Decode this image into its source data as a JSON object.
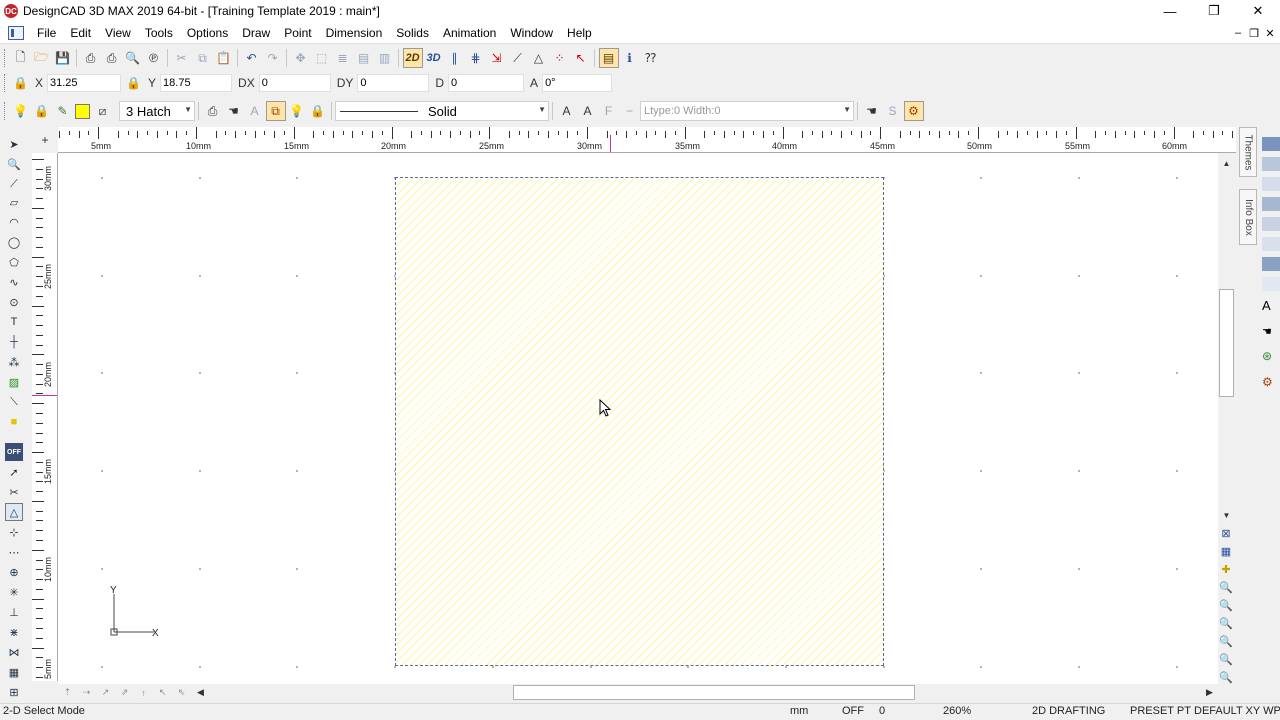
{
  "window": {
    "title": "DesignCAD 3D MAX 2019 64-bit - [Training Template 2019 : main*]",
    "app_icon": "DC",
    "controls": [
      "minimize-icon",
      "restore-icon",
      "close-icon"
    ]
  },
  "menu": {
    "items": [
      "File",
      "Edit",
      "View",
      "Tools",
      "Options",
      "Draw",
      "Point",
      "Dimension",
      "Solids",
      "Animation",
      "Window",
      "Help"
    ]
  },
  "coords": {
    "x_label": "X",
    "x_value": "31.25",
    "y_label": "Y",
    "y_value": "18.75",
    "dx_label": "DX",
    "dx_value": "0",
    "dy_label": "DY",
    "dy_value": "0",
    "d_label": "D",
    "d_value": "0",
    "a_label": "A",
    "a_value": "0°"
  },
  "attributes": {
    "fill_color": "#ffff00",
    "hatch_value": "3 Hatch",
    "line_style": "Solid",
    "ltype_placeholder": "Ltype:0  Width:0"
  },
  "ruler": {
    "h_labels": [
      "5mm",
      "10mm",
      "15mm",
      "20mm",
      "25mm",
      "30mm",
      "35mm",
      "40mm",
      "45mm",
      "50mm",
      "55mm",
      "60mm"
    ],
    "v_labels": [
      "30mm",
      "25mm",
      "20mm",
      "15mm",
      "10mm",
      "5mm"
    ]
  },
  "canvas": {
    "axis_y": "Y",
    "axis_x": "X",
    "hatch_color": "#fff3b0"
  },
  "dock": {
    "themes": "Themes",
    "info_box": "Info Box"
  },
  "status": {
    "mode": "2-D Select Mode",
    "units": "mm",
    "snap": "OFF",
    "snap_value": "0",
    "zoom": "260%",
    "workspace": "2D DRAFTING",
    "preset": "PRESET PT",
    "plane": "DEFAULT XY WP"
  }
}
